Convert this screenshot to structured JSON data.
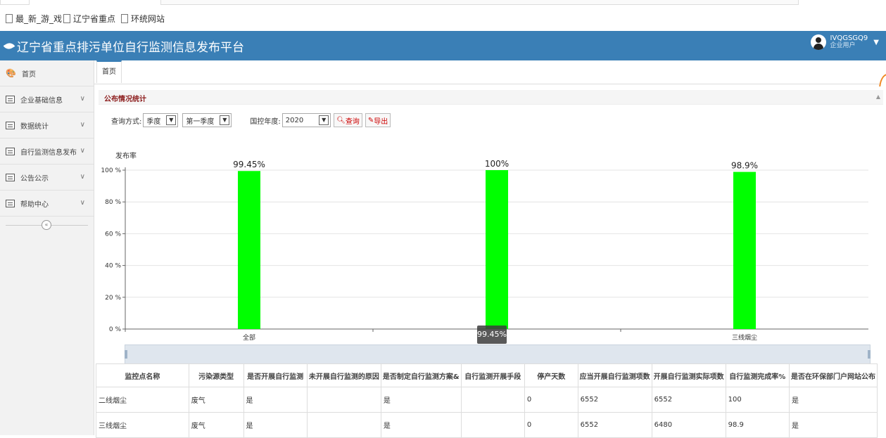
{
  "bookmarks": [
    {
      "label": "最_新_游_戏"
    },
    {
      "label": "辽宁省重点"
    },
    {
      "label": "环统网站"
    }
  ],
  "header": {
    "title": "辽宁省重点排污单位自行监测信息发布平台",
    "user_name": "IVQGSGQ9",
    "user_role": "企业用户"
  },
  "sidebar": {
    "items": [
      {
        "label": "首页"
      },
      {
        "label": "企业基础信息"
      },
      {
        "label": "数据统计"
      },
      {
        "label": "自行监测信息发布"
      },
      {
        "label": "公告公示"
      },
      {
        "label": "帮助中心"
      }
    ]
  },
  "tabs": [
    {
      "label": "首页"
    }
  ],
  "panel": {
    "title": "公布情况统计"
  },
  "filters": {
    "mode_label": "查询方式:",
    "mode_value": "季度",
    "quarter_value": "第一季度",
    "year_label": "国控年度:",
    "year_value": "2020",
    "query_button": "查询",
    "export_button": "导出"
  },
  "chart_data": {
    "type": "bar",
    "ylabel": "发布率",
    "ylim": [
      0,
      100
    ],
    "yticks": [
      "0 %",
      "20 %",
      "40 %",
      "60 %",
      "80 %",
      "100 %"
    ],
    "categories": [
      "全部",
      "",
      "三线烟尘"
    ],
    "values": [
      99.45,
      100,
      98.9
    ],
    "data_labels": [
      "99.45%",
      "100%",
      "98.9%"
    ],
    "bar_color": "#00ff00",
    "tooltip": "99.45%"
  },
  "table": {
    "headers": [
      "监控点名称",
      "污染源类型",
      "是否开展自行监测",
      "未开展自行监测的原因",
      "是否制定自行监测方案&",
      "自行监测开展手段",
      "停产天数",
      "应当开展自行监测项数",
      "开展自行监测实际项数",
      "自行监测完成率%",
      "是否在环保部门户网站公布"
    ],
    "rows": [
      [
        "二线烟尘",
        "废气",
        "是",
        "",
        "是",
        "",
        "0",
        "6552",
        "6552",
        "100",
        "是"
      ],
      [
        "三线烟尘",
        "废气",
        "是",
        "",
        "是",
        "",
        "0",
        "6552",
        "6480",
        "98.9",
        "是"
      ]
    ]
  }
}
